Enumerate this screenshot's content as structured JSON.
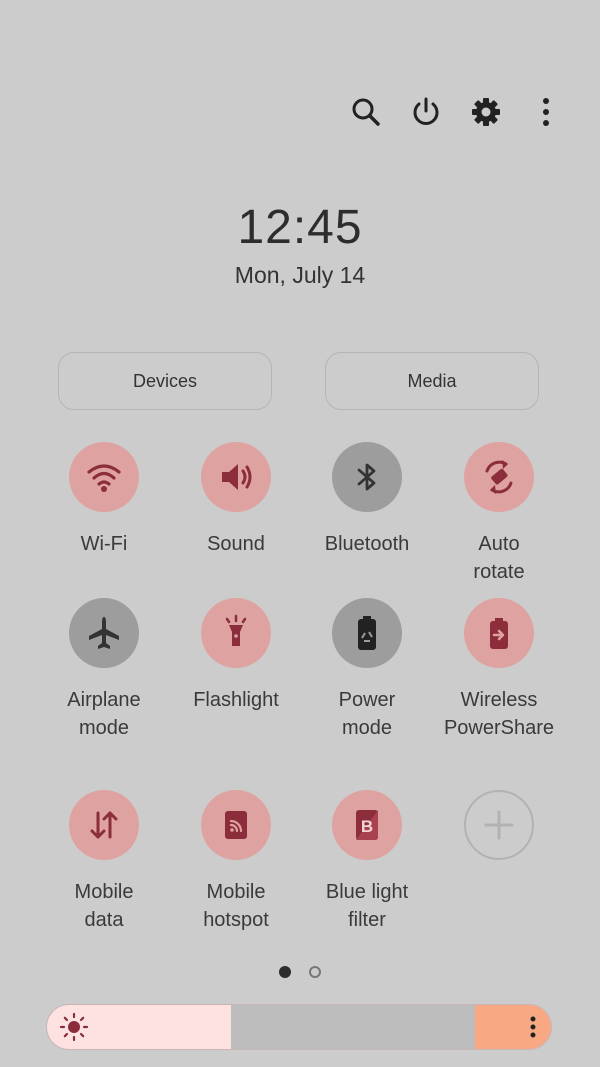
{
  "clock": {
    "time": "12:45",
    "date": "Mon, July 14"
  },
  "top_actions": [
    "search-icon",
    "power-icon",
    "settings-icon",
    "more-options-icon"
  ],
  "panels": {
    "devices": "Devices",
    "media": "Media"
  },
  "tiles": [
    {
      "label": "Wi-Fi",
      "icon": "wifi-icon",
      "state": "on"
    },
    {
      "label": "Sound",
      "icon": "speaker-icon",
      "state": "on"
    },
    {
      "label": "Bluetooth",
      "icon": "bluetooth-icon",
      "state": "off"
    },
    {
      "label": "Auto\nrotate",
      "icon": "auto-rotate-icon",
      "state": "on"
    },
    {
      "label": "Airplane\nmode",
      "icon": "airplane-icon",
      "state": "off"
    },
    {
      "label": "Flashlight",
      "icon": "flashlight-icon",
      "state": "on"
    },
    {
      "label": "Power\nmode",
      "icon": "battery-recycle-icon",
      "state": "off"
    },
    {
      "label": "Wireless\nPowerShare",
      "icon": "powershare-icon",
      "state": "on"
    },
    {
      "label": "Mobile\ndata",
      "icon": "data-arrows-icon",
      "state": "on"
    },
    {
      "label": "Mobile\nhotspot",
      "icon": "hotspot-icon",
      "state": "on"
    },
    {
      "label": "Blue light\nfilter",
      "icon": "blue-light-filter-icon",
      "state": "on"
    },
    {
      "label": "",
      "icon": "add-icon",
      "state": "add"
    }
  ],
  "pager": {
    "pages": 2,
    "current": 1
  },
  "brightness": {
    "level": 0.43,
    "icon": "sun-icon",
    "menu_icon": "more-options-icon"
  },
  "colors": {
    "background": "#cccccc",
    "tile_on": "#dea3a1",
    "tile_off": "#9d9d9d",
    "icon_on": "#8b2d3a",
    "accent_end": "#f8a984",
    "brightness_fill": "#fde2e1"
  }
}
